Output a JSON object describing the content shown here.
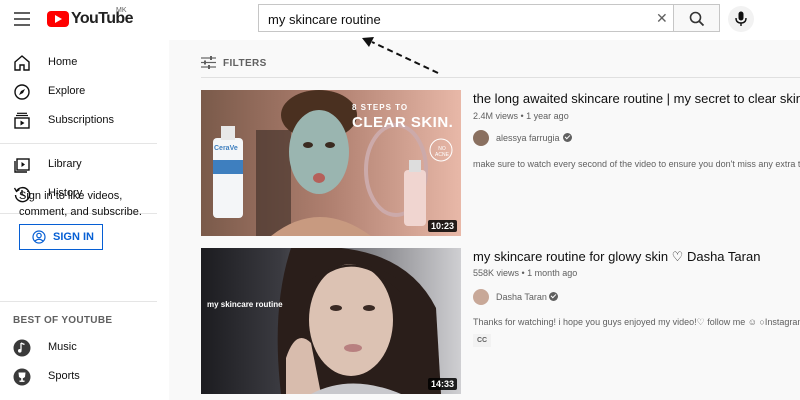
{
  "app": {
    "logo_text": "YouTube",
    "country": "MK",
    "brand_color": "#ff0000"
  },
  "search": {
    "value": "my skincare routine",
    "clear_icon": "close-icon",
    "search_icon": "search-icon",
    "mic_icon": "microphone-icon"
  },
  "sidebar": {
    "items": [
      {
        "label": "Home",
        "icon": "home-icon"
      },
      {
        "label": "Explore",
        "icon": "compass-icon"
      },
      {
        "label": "Subscriptions",
        "icon": "subscriptions-icon"
      },
      {
        "label": "Library",
        "icon": "library-icon"
      },
      {
        "label": "History",
        "icon": "history-icon"
      }
    ],
    "signin_text": "Sign in to like videos, comment, and subscribe.",
    "signin_button": "SIGN IN",
    "best_of_label": "BEST OF YOUTUBE",
    "best_items": [
      {
        "label": "Music",
        "icon": "music-icon"
      },
      {
        "label": "Sports",
        "icon": "trophy-icon"
      }
    ]
  },
  "filters": {
    "label": "FILTERS",
    "icon": "filters-icon"
  },
  "results": [
    {
      "title": "the long awaited skincare routine | my secret to clear skin",
      "meta": "2.4M views • 1 year ago",
      "channel": "alessya farrugia",
      "verified": true,
      "description": "make sure to watch every second of the video to ensure you don't miss any extra tips",
      "duration": "10:23",
      "thumb_text_small": "8 STEPS TO",
      "thumb_text_big": "CLEAR SKIN.",
      "thumb_badge": "NO ACNE",
      "thumb_bottle_label": "CeraVe"
    },
    {
      "title": "my skincare routine for glowy skin ♡ Dasha Taran",
      "meta": "558K views • 1 month ago",
      "channel": "Dasha Taran",
      "verified": true,
      "description": "Thanks for watching! i hope you guys enjoyed my video!♡ follow me ☺ ○Instagram:",
      "duration": "14:33",
      "thumb_text": "my skincare routine",
      "badge": "CC"
    }
  ]
}
